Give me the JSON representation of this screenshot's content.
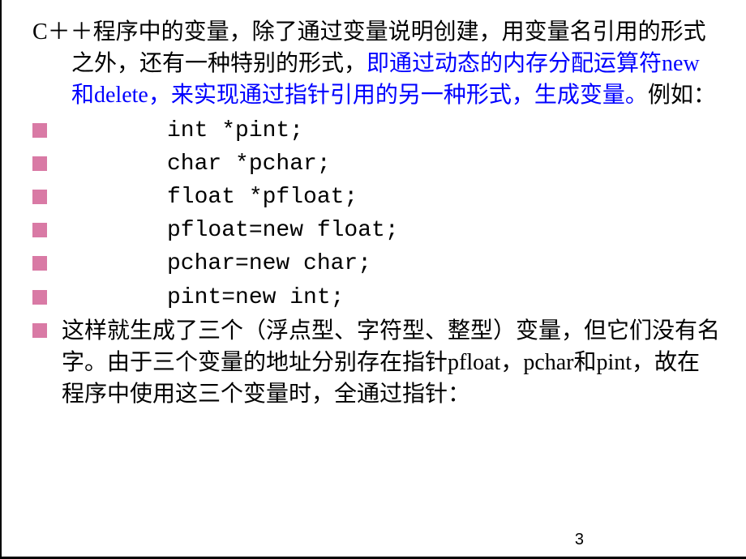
{
  "intro": {
    "part1": "C＋＋程序中的变量，除了通过变量说明创建，用变量名引用的形式之外，还有一种特别的形式，",
    "blue": "即通过动态的内存分配运算符new和delete，来实现通过指针引用的另一种形式，生成变量。",
    "part2": "例如："
  },
  "code_lines": [
    "int *pint;",
    "char *pchar;",
    "float *pfloat;",
    "pfloat=new float;",
    "pchar=new char;",
    "pint=new int;"
  ],
  "conclusion": "这样就生成了三个（浮点型、字符型、整型）变量，但它们没有名字。由于三个变量的地址分别存在指针pfloat，pchar和pint，故在程序中使用这三个变量时，全通过指针：",
  "page_number": "3"
}
